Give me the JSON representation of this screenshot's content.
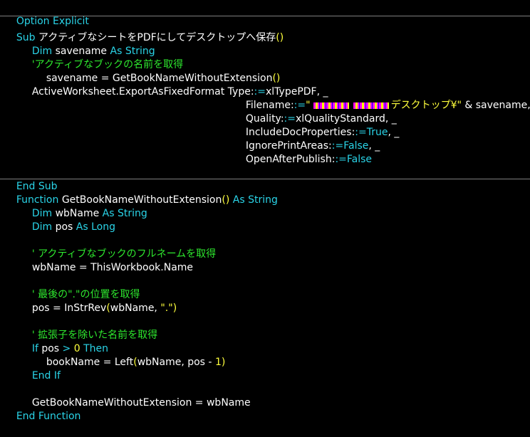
{
  "colors": {
    "background": "#000000",
    "keyword": "#2ad4e8",
    "identifier": "#ffffff",
    "comment": "#2ee82e",
    "string_number": "#ffff3c",
    "separator": "#7f7f7f"
  },
  "code": {
    "l1": {
      "a": "Option Explicit"
    },
    "l2": {
      "a": "Sub",
      "b": " アクティブなシートをPDFにしてデスクトップへ保存",
      "c": "()"
    },
    "l3": {
      "a": "Dim",
      "b": " savename ",
      "c": "As String"
    },
    "l4": {
      "a": "'アクティブなブックの名前を取得"
    },
    "l5": {
      "a": "savename = GetBookNameWithoutExtension",
      "b": "()"
    },
    "l6": {
      "a": "ActiveWorksheet.ExportAsFixedFormat Type:",
      "b": ":=",
      "c": "xlTypePDF, _"
    },
    "l7": {
      "a": "Filename:",
      "b": ":=",
      "c": "\"",
      "d": "デスクトップ¥\"",
      "e": " & savename, _"
    },
    "l8": {
      "a": "Quality:",
      "b": ":=",
      "c": "xlQualityStandard, _"
    },
    "l9": {
      "a": "IncludeDocProperties:",
      "b": ":=",
      "c": "True",
      "d": ", _"
    },
    "l10": {
      "a": "IgnorePrintAreas:",
      "b": ":=",
      "c": "False",
      "d": ", _"
    },
    "l11": {
      "a": "OpenAfterPublish:",
      "b": ":=",
      "c": "False"
    },
    "l12": {
      "a": "End Sub"
    },
    "l13": {
      "a": "Function",
      "b": " GetBookNameWithoutExtension",
      "c": "()",
      "d": " As String"
    },
    "l14": {
      "a": "Dim",
      "b": " wbName ",
      "c": "As String"
    },
    "l15": {
      "a": "Dim",
      "b": " pos ",
      "c": "As Long"
    },
    "l16": {
      "a": "' アクティブなブックのフルネームを取得"
    },
    "l17": {
      "a": "wbName = ThisWorkbook.Name"
    },
    "l18": {
      "a": "' 最後の\".\"の位置を取得"
    },
    "l19": {
      "a": "pos = InStrRev",
      "b": "(",
      "c": "wbName, ",
      "d": "\".\"",
      "e": ")"
    },
    "l20": {
      "a": "' 拡張子を除いた名前を取得"
    },
    "l21": {
      "a": "If",
      "b": " pos ",
      "c": ">",
      "d": " 0 ",
      "e": "Then"
    },
    "l22": {
      "a": "bookName = Left",
      "b": "(",
      "c": "wbName, pos - ",
      "d": "1",
      "e": ")"
    },
    "l23": {
      "a": "End If"
    },
    "l24": {
      "a": "GetBookNameWithoutExtension = wbName"
    },
    "l25": {
      "a": "End Function"
    }
  }
}
